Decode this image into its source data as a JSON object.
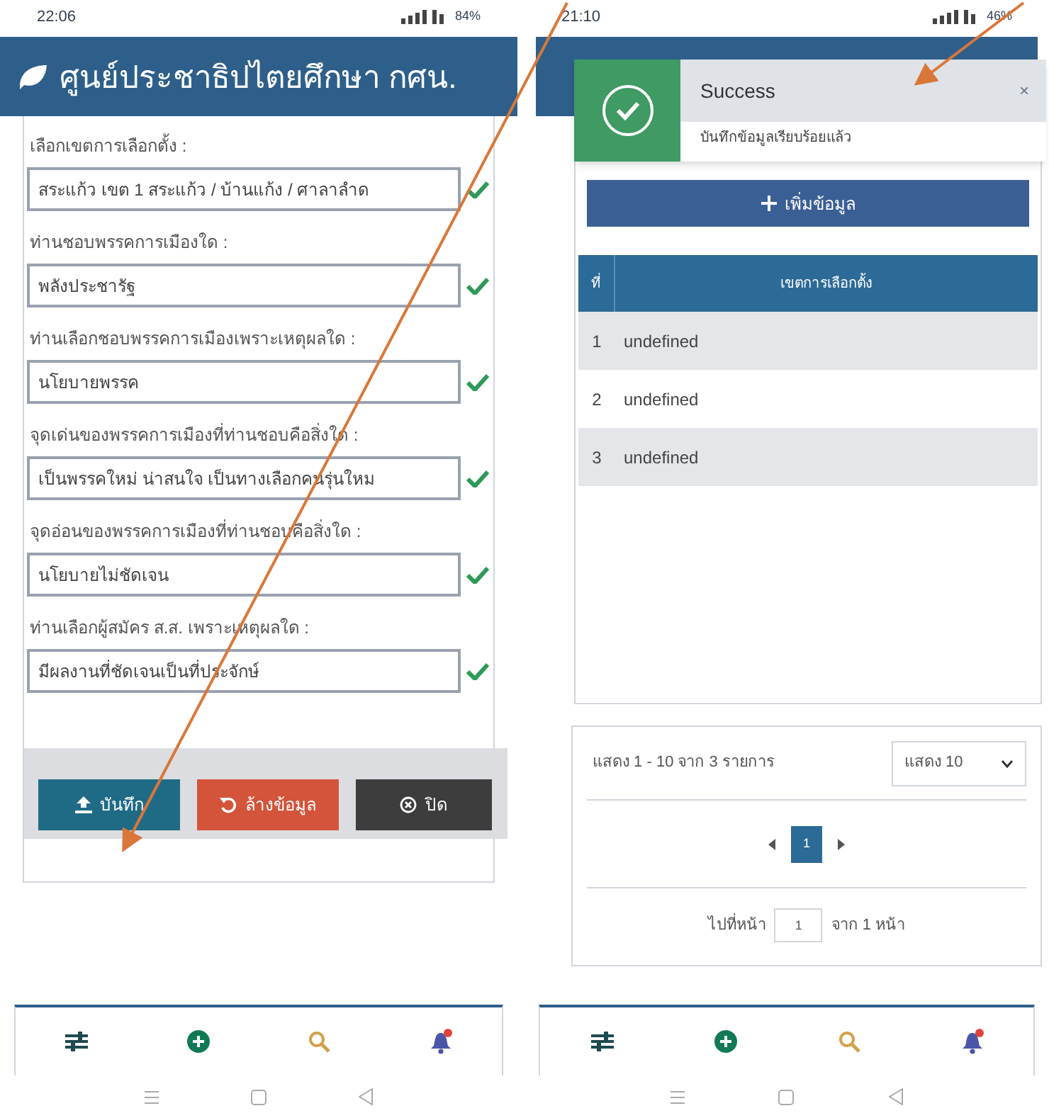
{
  "left_screen": {
    "status_bar": {
      "time": "22:06",
      "battery": "84%"
    },
    "header": {
      "title": "ศูนย์ประชาธิปไตยศึกษา กศน."
    },
    "fields": [
      {
        "label": "เลือกเขตการเลือกตั้ง :",
        "value": "สระแก้ว เขต 1 สระแก้ว / บ้านแก้ง / ศาลาลำด",
        "valid": true
      },
      {
        "label": "ท่านชอบพรรคการเมืองใด :",
        "value": "พลังประชารัฐ",
        "valid": true
      },
      {
        "label": "ท่านเลือกชอบพรรคการเมืองเพราะเหตุผลใด :",
        "value": "นโยบายพรรค",
        "valid": true
      },
      {
        "label": "จุดเด่นของพรรคการเมืองที่ท่านชอบคือสิ่งใด :",
        "value": "เป็นพรรคใหม่ น่าสนใจ เป็นทางเลือกคนรุ่นใหม",
        "valid": true
      },
      {
        "label": "จุดอ่อนของพรรคการเมืองที่ท่านชอบคือสิ่งใด :",
        "value": "นโยบายไม่ชัดเจน",
        "valid": true
      },
      {
        "label": "ท่านเลือกผู้สมัคร ส.ส. เพราะเหตุผลใด :",
        "value": "มีผลงานที่ชัดเจนเป็นที่ประจักษ์",
        "valid": true
      }
    ],
    "buttons": [
      {
        "kind": "save",
        "label": "บันทึก"
      },
      {
        "kind": "reset",
        "label": "ล้างข้อมูล"
      },
      {
        "kind": "close",
        "label": "ปิด"
      }
    ]
  },
  "right_screen": {
    "status_bar": {
      "time": "21:10",
      "battery": "46%"
    },
    "toast": {
      "title": "Success",
      "message": "บันทึกข้อมูลเรียบร้อยแล้ว",
      "close": "×"
    },
    "add_button": {
      "label": "เพิ่มข้อมูล"
    },
    "table": {
      "columns": [
        "ที่",
        "เขตการเลือกตั้ง"
      ],
      "rows": [
        [
          "1",
          "undefined"
        ],
        [
          "2",
          "undefined"
        ],
        [
          "3",
          "undefined"
        ]
      ]
    },
    "pagination": {
      "summary": "แสดง 1 - 10 จาก 3 รายการ",
      "page_size": "แสดง 10",
      "pages": [
        {
          "label": "1",
          "selected": true
        }
      ],
      "goto_label": "ไปที่หน้า",
      "goto_value": "1",
      "goto_suffix": "จาก 1 หน้า"
    }
  }
}
